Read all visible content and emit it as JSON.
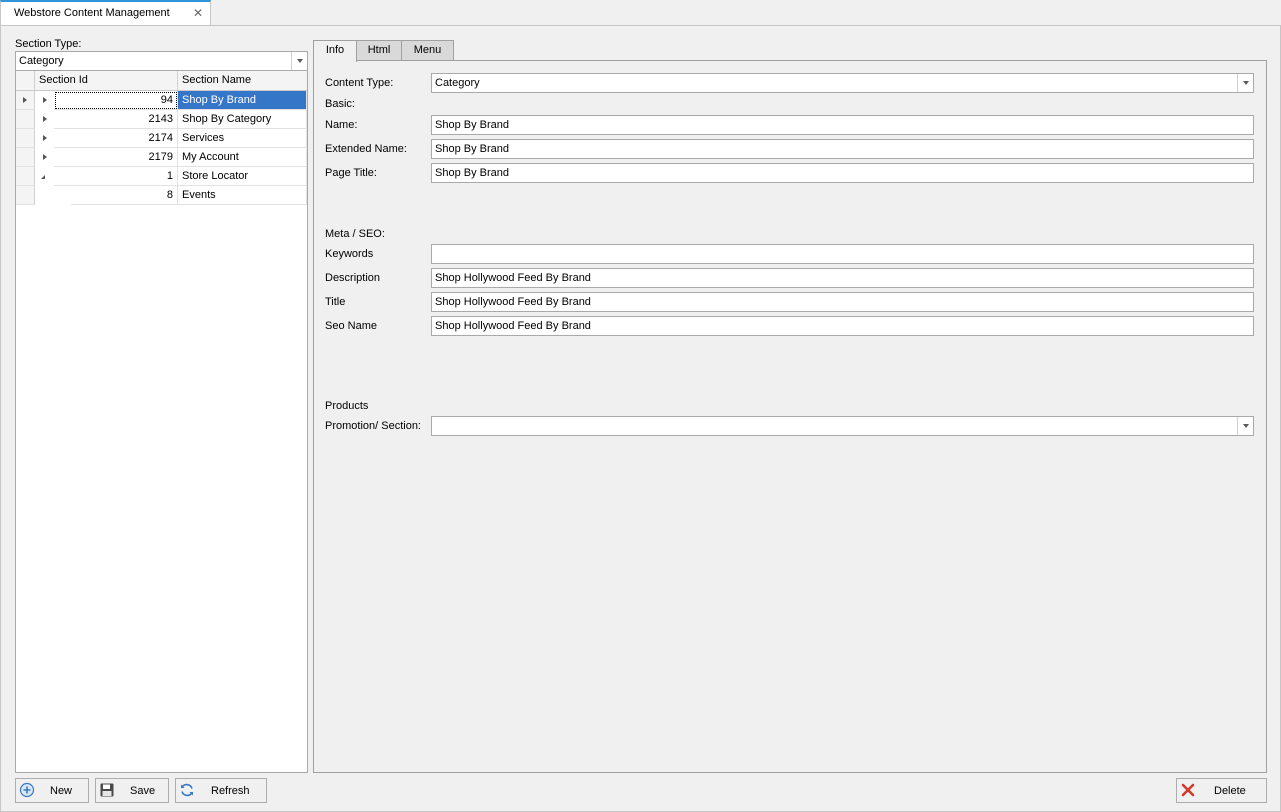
{
  "window": {
    "tab_title": "Webstore Content Management",
    "close_glyph": "✕"
  },
  "left": {
    "section_type_label": "Section Type:",
    "section_type_value": "Category",
    "columns": [
      "Section Id",
      "Section Name"
    ],
    "rows": [
      {
        "id": "94",
        "name": "Shop By Brand",
        "expander": "closed",
        "selected": true
      },
      {
        "id": "2143",
        "name": "Shop By Category",
        "expander": "closed",
        "selected": false
      },
      {
        "id": "2174",
        "name": "Services",
        "expander": "closed",
        "selected": false
      },
      {
        "id": "2179",
        "name": "My Account",
        "expander": "closed",
        "selected": false
      },
      {
        "id": "1",
        "name": "Store Locator",
        "expander": "open",
        "selected": false
      },
      {
        "id": "8",
        "name": "Events",
        "expander": "none",
        "selected": false,
        "child": true
      }
    ]
  },
  "tabs": [
    {
      "label": "Info",
      "active": true
    },
    {
      "label": "Html",
      "active": false
    },
    {
      "label": "Menu",
      "active": false
    }
  ],
  "info": {
    "content_type_label": "Content Type:",
    "content_type_value": "Category",
    "basic_heading": "Basic:",
    "name_label": "Name:",
    "name_value": "Shop By Brand",
    "extended_name_label": "Extended Name:",
    "extended_name_value": "Shop By Brand",
    "page_title_label": "Page Title:",
    "page_title_value": "Shop By Brand",
    "meta_heading": "Meta / SEO:",
    "keywords_label": "Keywords",
    "keywords_value": "",
    "description_label": "Description",
    "description_value": "Shop Hollywood Feed By Brand",
    "title_label": "Title",
    "title_value": "Shop Hollywood Feed By Brand",
    "seo_name_label": "Seo Name",
    "seo_name_value": "Shop Hollywood Feed By Brand",
    "products_heading": "Products",
    "promotion_label": "Promotion/ Section:",
    "promotion_value": ""
  },
  "buttons": {
    "new": "New",
    "save": "Save",
    "refresh": "Refresh",
    "delete": "Delete"
  },
  "colors": {
    "selection": "#3676c8",
    "accent": "#2f95d6"
  }
}
